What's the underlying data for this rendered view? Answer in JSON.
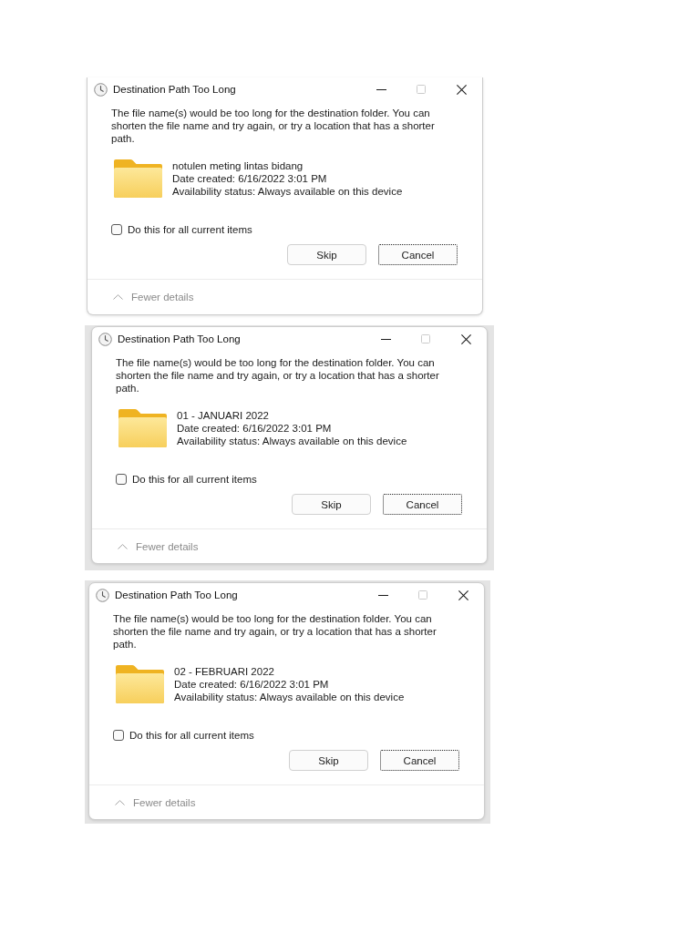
{
  "dialogs": [
    {
      "title": "Destination Path Too Long",
      "window_buttons": [
        {
          "kind": "minimize",
          "disabled": false
        },
        {
          "kind": "maximize",
          "disabled": true
        },
        {
          "kind": "close",
          "disabled": false
        }
      ],
      "message": "The file name(s) would be too long for the destination folder. You can shorten the file name and try again, or try a location that has a shorter path.",
      "file": {
        "name": "notulen meting lintas bidang",
        "date_created": "Date created: 6/16/2022 3:01 PM",
        "availability_status": "Availability status: Always available on this device"
      },
      "checkbox": {
        "label": "Do this for all current items",
        "checked": false
      },
      "buttons": [
        {
          "label": "Skip",
          "focused": false
        },
        {
          "label": "Cancel",
          "focused": true
        }
      ],
      "details_toggle": {
        "label": "Fewer details",
        "expanded": true
      }
    },
    {
      "title": "Destination Path Too Long",
      "window_buttons": [
        {
          "kind": "minimize",
          "disabled": false
        },
        {
          "kind": "maximize",
          "disabled": true
        },
        {
          "kind": "close",
          "disabled": false
        }
      ],
      "message": "The file name(s) would be too long for the destination folder. You can shorten the file name and try again, or try a location that has a shorter path.",
      "file": {
        "name": "01 - JANUARI 2022",
        "date_created": "Date created: 6/16/2022 3:01 PM",
        "availability_status": "Availability status: Always available on this device"
      },
      "checkbox": {
        "label": "Do this for all current items",
        "checked": false
      },
      "buttons": [
        {
          "label": "Skip",
          "focused": false
        },
        {
          "label": "Cancel",
          "focused": true
        }
      ],
      "details_toggle": {
        "label": "Fewer details",
        "expanded": true
      }
    },
    {
      "title": "Destination Path Too Long",
      "window_buttons": [
        {
          "kind": "minimize",
          "disabled": false
        },
        {
          "kind": "maximize",
          "disabled": true
        },
        {
          "kind": "close",
          "disabled": false
        }
      ],
      "message": "The file name(s) would be too long for the destination folder. You can shorten the file name and try again, or try a location that has a shorter path.",
      "file": {
        "name": "02 - FEBRUARI 2022",
        "date_created": "Date created: 6/16/2022 3:01 PM",
        "availability_status": "Availability status: Always available on this device"
      },
      "checkbox": {
        "label": "Do this for all current items",
        "checked": false
      },
      "buttons": [
        {
          "label": "Skip",
          "focused": false
        },
        {
          "label": "Cancel",
          "focused": true
        }
      ],
      "details_toggle": {
        "label": "Fewer details",
        "expanded": true
      }
    }
  ]
}
